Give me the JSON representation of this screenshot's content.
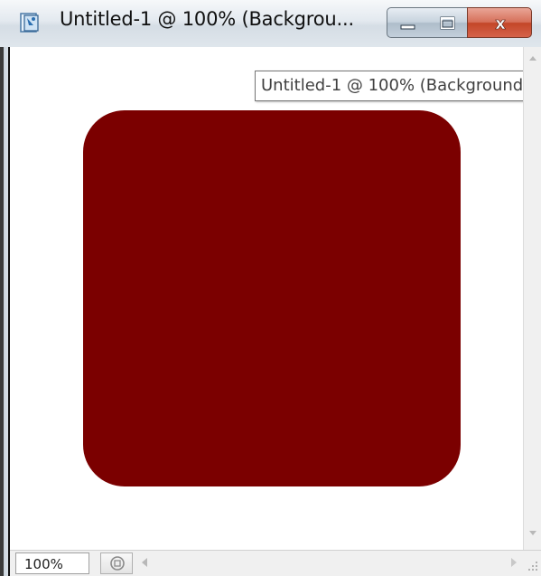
{
  "window": {
    "title": "Untitled-1 @ 100% (Backgrou...",
    "icon": "photoshop-document-icon"
  },
  "window_controls": {
    "minimize_icon": "minimize-icon",
    "maximize_icon": "maximize-icon",
    "close_label": "x"
  },
  "tooltip": {
    "text": "Untitled-1 @ 100% (Background"
  },
  "canvas": {
    "background": "#ffffff",
    "shape": "rounded-rectangle",
    "shape_color": "#7b0000"
  },
  "statusbar": {
    "zoom": "100%",
    "info_icon": "document-info-icon"
  },
  "colors": {
    "close_button": "#c9472b",
    "titlebar": "#dde4ea"
  }
}
